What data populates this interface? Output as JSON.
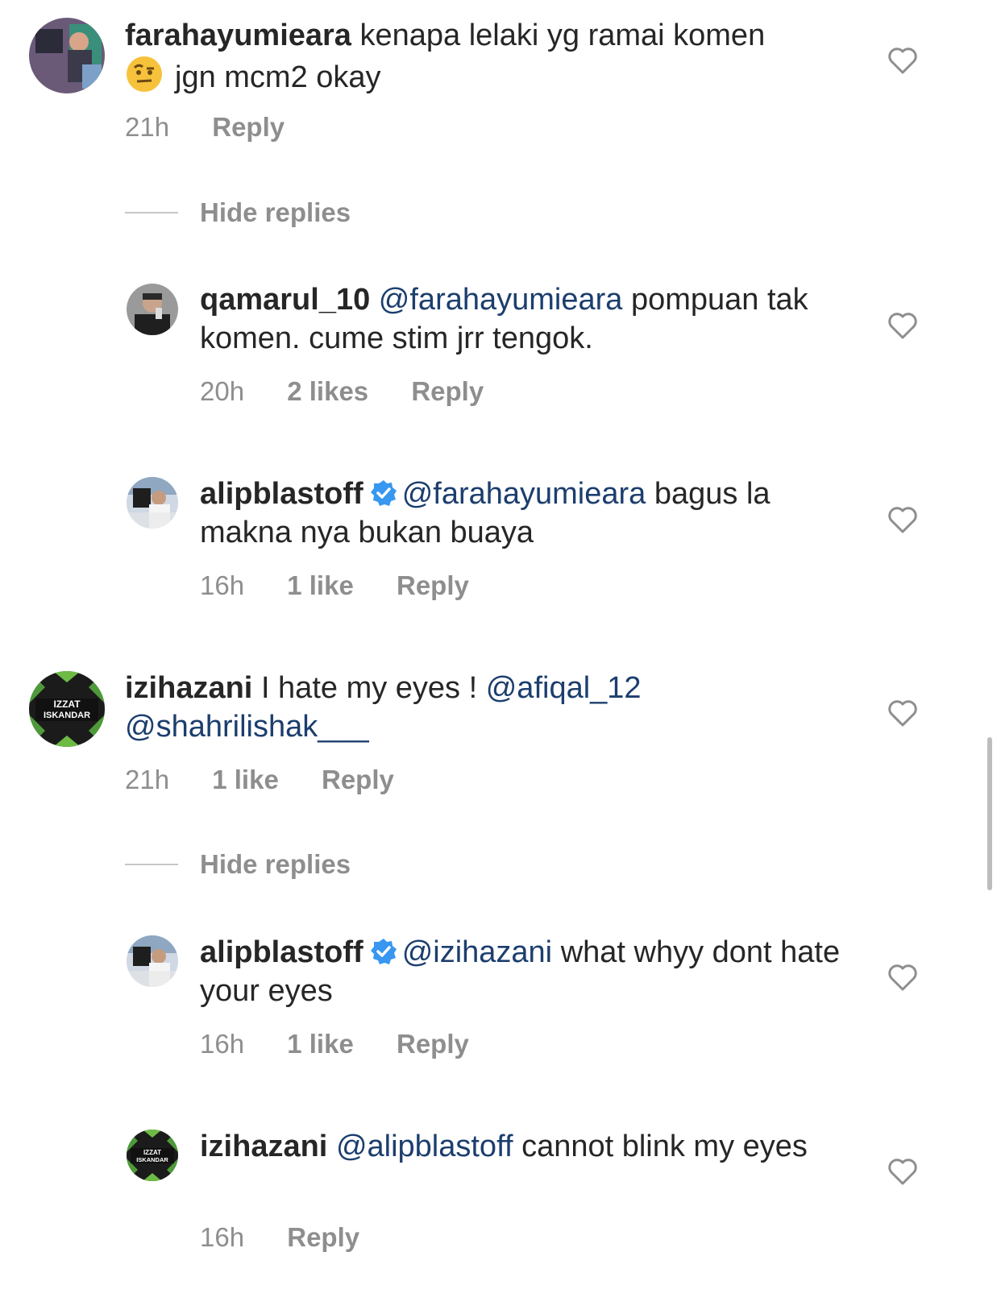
{
  "comments": [
    {
      "user": "farahayumieara",
      "segments": [
        {
          "t": "kenapa lelaki yg ramai komen"
        },
        {
          "t": "jgn mcm2 okay"
        }
      ],
      "emoji": "raised-eyebrow-face",
      "time": "21h",
      "likes": "",
      "reply": "Reply",
      "hide_replies": "Hide replies",
      "replies": [
        {
          "user": "qamarul_10",
          "mention": "@farahayumieara",
          "text": "pompuan tak komen. cume stim jrr tengok.",
          "time": "20h",
          "likes": "2 likes",
          "reply": "Reply"
        },
        {
          "user": "alipblastoff",
          "verified": true,
          "mention": "@farahayumieara",
          "text": "bagus la makna nya bukan buaya",
          "time": "16h",
          "likes": "1 like",
          "reply": "Reply"
        }
      ]
    },
    {
      "user": "izihazani",
      "text": "I hate my eyes !",
      "mention1": "@afiqal_12",
      "mention2": "@shahrilishak___",
      "avatar_text": [
        "IZZAT",
        "ISKANDAR"
      ],
      "time": "21h",
      "likes": "1 like",
      "reply": "Reply",
      "hide_replies": "Hide replies",
      "replies": [
        {
          "user": "alipblastoff",
          "verified": true,
          "mention": "@izihazani",
          "text": "what whyy dont hate your eyes",
          "time": "16h",
          "likes": "1 like",
          "reply": "Reply"
        },
        {
          "user": "izihazani",
          "mention": "@alipblastoff",
          "text": "cannot blink my eyes",
          "time": "16h",
          "likes": "",
          "reply": "Reply"
        }
      ]
    }
  ],
  "colors": {
    "mention": "#1c3e6e",
    "meta": "#8e8e8e",
    "verified": "#3897f0"
  }
}
